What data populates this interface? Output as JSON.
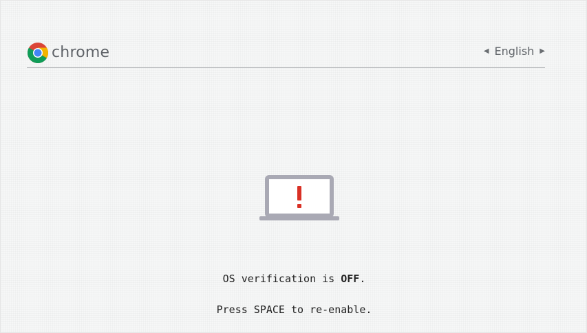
{
  "header": {
    "brand": "chrome",
    "brand_icon": "chrome-logo-icon",
    "language": "English",
    "prev_icon": "triangle-left-icon",
    "next_icon": "triangle-right-icon"
  },
  "illustration": {
    "icon": "laptop-warning-icon",
    "colors": {
      "laptop": "#a9a9b4",
      "warning": "#d93025"
    }
  },
  "message": {
    "line1_prefix": "OS verification is",
    "line1_status": "OFF",
    "line1_suffix": ".",
    "line2": "Press SPACE to re-enable."
  },
  "colors": {
    "background": "#f6f7f7",
    "text": "#222222",
    "header_text": "#5f6368",
    "divider": "#b7b9bc"
  }
}
